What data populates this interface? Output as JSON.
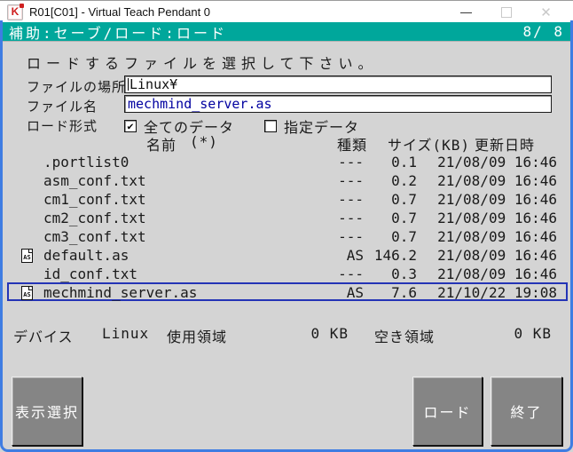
{
  "window": {
    "title": "R01[C01] - Virtual Teach Pendant 0",
    "app_icon_letter": "K",
    "controls": {
      "minimize": "—",
      "close": "✕"
    }
  },
  "header": {
    "title": "補助:セーブ/ロード:ロード",
    "page_indicator": "8/ 8"
  },
  "form": {
    "prompt": "ロードするファイルを選択して下さい。",
    "location_label": "ファイルの場所",
    "location_value": "Linux¥",
    "filename_label": "ファイル名",
    "filename_value": "mechmind_server.as",
    "format_label": "ロード形式",
    "checkbox_all": {
      "label": "全てのデータ",
      "checked": true,
      "check_glyph": "✔"
    },
    "checkbox_specified": {
      "label": "指定データ",
      "checked": false,
      "check_glyph": ""
    }
  },
  "file_list": {
    "headers": {
      "name": "名前",
      "star": "(*)",
      "type": "種類",
      "size": "サイズ(KB)",
      "modified": "更新日時"
    },
    "rows": [
      {
        "icon": "",
        "name": ".portlist0",
        "type": "---",
        "size": "0.1",
        "modified": "21/08/09 16:46",
        "selected": false
      },
      {
        "icon": "",
        "name": "asm_conf.txt",
        "type": "---",
        "size": "0.2",
        "modified": "21/08/09 16:46",
        "selected": false
      },
      {
        "icon": "",
        "name": "cm1_conf.txt",
        "type": "---",
        "size": "0.7",
        "modified": "21/08/09 16:46",
        "selected": false
      },
      {
        "icon": "",
        "name": "cm2_conf.txt",
        "type": "---",
        "size": "0.7",
        "modified": "21/08/09 16:46",
        "selected": false
      },
      {
        "icon": "",
        "name": "cm3_conf.txt",
        "type": "---",
        "size": "0.7",
        "modified": "21/08/09 16:46",
        "selected": false
      },
      {
        "icon": "AS",
        "name": "default.as",
        "type": "AS",
        "size": "146.2",
        "modified": "21/08/09 16:46",
        "selected": false
      },
      {
        "icon": "",
        "name": "id_conf.txt",
        "type": "---",
        "size": "0.3",
        "modified": "21/08/09 16:46",
        "selected": false
      },
      {
        "icon": "AS",
        "name": "mechmind_server.as",
        "type": "AS",
        "size": "7.6",
        "modified": "21/10/22 19:08",
        "selected": true
      }
    ]
  },
  "status": {
    "device_label": "デバイス",
    "device_value": "Linux",
    "used_label": "使用領域",
    "used_value": "0 KB",
    "free_label": "空き領域",
    "free_value": "0 KB"
  },
  "buttons": {
    "display_select": "表示選択",
    "load": "ロード",
    "exit": "終了"
  },
  "colors": {
    "header_bg": "#00a79b",
    "selection_border": "#2434b6",
    "button_bg": "#858585",
    "window_border": "#3f7de2",
    "filename_text": "#0000a0",
    "content_bg": "#d4d4d4"
  }
}
